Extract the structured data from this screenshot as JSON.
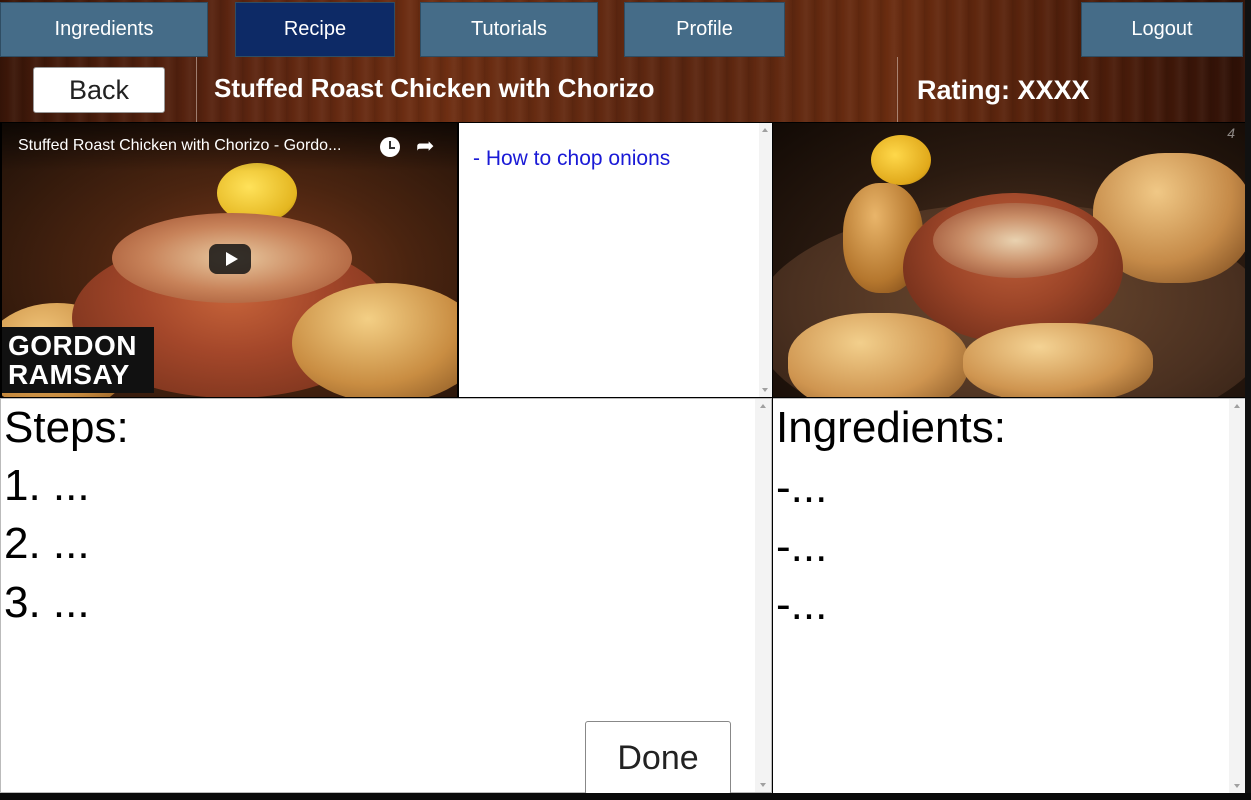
{
  "nav": {
    "tabs": [
      {
        "label": "Ingredients",
        "active": false
      },
      {
        "label": "Recipe",
        "active": true
      },
      {
        "label": "Tutorials",
        "active": false
      },
      {
        "label": "Profile",
        "active": false
      }
    ],
    "logout_label": "Logout"
  },
  "header": {
    "back_label": "Back",
    "title": "Stuffed Roast Chicken with Chorizo",
    "rating": "Rating: XXXX"
  },
  "video": {
    "title": "Stuffed Roast Chicken with Chorizo - Gordo...",
    "brand_line1": "GORDON",
    "brand_line2": "RAMSAY",
    "icons": [
      "clock-icon",
      "share-icon",
      "play-icon"
    ]
  },
  "tutorials": {
    "links": [
      "- How to chop onions"
    ]
  },
  "dish_image": {
    "watermark": "4"
  },
  "steps": {
    "heading": "Steps:",
    "items": [
      "1. ...",
      "2. ...",
      "3. ..."
    ],
    "done_label": "Done"
  },
  "ingredients": {
    "heading": "Ingredients:",
    "items": [
      "-...",
      "-...",
      "-..."
    ]
  },
  "colors": {
    "tab": "#456c88",
    "tab_active": "#0d2a66",
    "link": "#1a1ad6"
  }
}
